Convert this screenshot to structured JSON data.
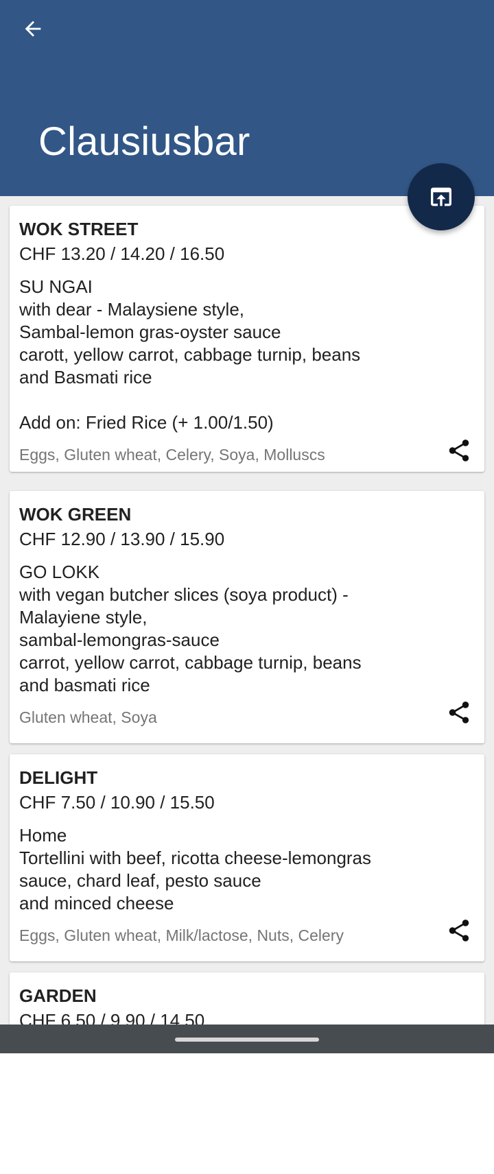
{
  "appbar": {
    "title": "Clausiusbar",
    "back_icon": "arrow-back-icon",
    "color": "#325787"
  },
  "fab": {
    "icon": "open-in-browser-icon",
    "color": "#13294a"
  },
  "menu": [
    {
      "title": "WOK STREET",
      "price": "CHF 13.20 / 14.20 / 16.50",
      "description": "SU NGAI\nwith dear - Malaysiene style,\nSambal-lemon gras-oyster sauce\ncarott, yellow carrot, cabbage turnip, beans\nand Basmati rice\n\nAdd on: Fried Rice (+ 1.00/1.50)",
      "allergens": "Eggs, Gluten wheat, Celery, Soya, Molluscs"
    },
    {
      "title": "WOK GREEN",
      "price": "CHF 12.90 / 13.90 / 15.90",
      "description": "GO LOKK\nwith vegan butcher slices (soya product) -\nMalayiene style,\nsambal-lemongras-sauce\ncarrot, yellow carrot, cabbage turnip, beans\nand basmati rice",
      "allergens": "Gluten wheat, Soya"
    },
    {
      "title": "DELIGHT",
      "price": "CHF 7.50 / 10.90 / 15.50",
      "description": "Home\nTortellini with beef, ricotta cheese-lemongras\nsauce, chard leaf, pesto sauce\nand minced cheese",
      "allergens": "Eggs, Gluten wheat, Milk/lactose, Nuts, Celery"
    },
    {
      "title": "GARDEN",
      "price": "CHF 6.50 / 9.90 / 14.50"
    }
  ],
  "share_icon": "share-icon"
}
